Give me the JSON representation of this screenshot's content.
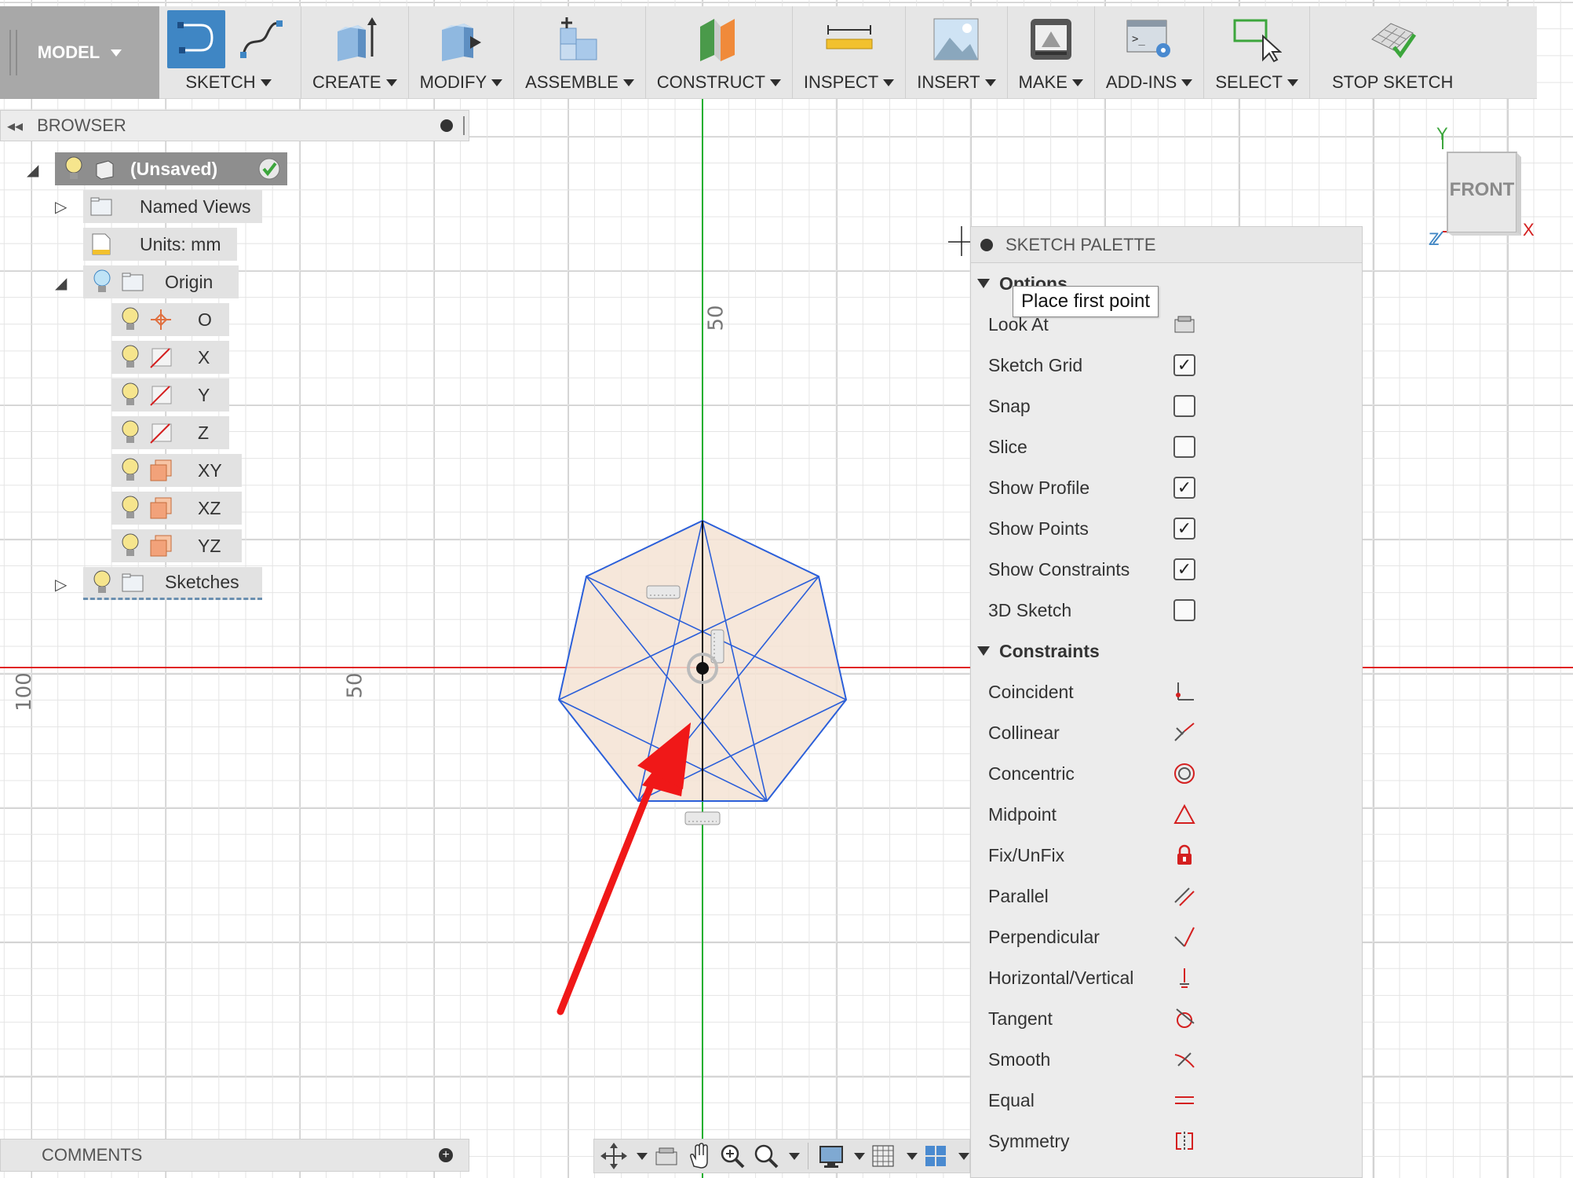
{
  "toolbar": {
    "model_label": "MODEL",
    "groups": [
      {
        "label": "SKETCH"
      },
      {
        "label": "CREATE"
      },
      {
        "label": "MODIFY"
      },
      {
        "label": "ASSEMBLE"
      },
      {
        "label": "CONSTRUCT"
      },
      {
        "label": "INSPECT"
      },
      {
        "label": "INSERT"
      },
      {
        "label": "MAKE"
      },
      {
        "label": "ADD-INS"
      },
      {
        "label": "SELECT"
      },
      {
        "label": "STOP SKETCH"
      }
    ]
  },
  "browser": {
    "title": "BROWSER",
    "items": [
      {
        "label": "(Unsaved)"
      },
      {
        "label": "Named Views"
      },
      {
        "label": "Units: mm"
      },
      {
        "label": "Origin"
      },
      {
        "label": "O"
      },
      {
        "label": "X"
      },
      {
        "label": "Y"
      },
      {
        "label": "Z"
      },
      {
        "label": "XY"
      },
      {
        "label": "XZ"
      },
      {
        "label": "YZ"
      },
      {
        "label": "Sketches"
      }
    ]
  },
  "canvas": {
    "ruler_labels": [
      "50",
      "100",
      "50"
    ]
  },
  "viewcube": {
    "face": "FRONT",
    "axes": [
      "Y",
      "X",
      "Z"
    ]
  },
  "palette": {
    "title": "SKETCH PALETTE",
    "options_label": "Options",
    "options": [
      {
        "label": "Look At",
        "control": "look-at-icon"
      },
      {
        "label": "Sketch Grid",
        "checked": true
      },
      {
        "label": "Snap",
        "checked": false
      },
      {
        "label": "Slice",
        "checked": false
      },
      {
        "label": "Show Profile",
        "checked": true
      },
      {
        "label": "Show Points",
        "checked": true
      },
      {
        "label": "Show Constraints",
        "checked": true
      },
      {
        "label": "3D Sketch",
        "checked": false
      }
    ],
    "constraints_label": "Constraints",
    "constraints": [
      {
        "label": "Coincident",
        "icon": "coincident-icon"
      },
      {
        "label": "Collinear",
        "icon": "collinear-icon"
      },
      {
        "label": "Concentric",
        "icon": "concentric-icon"
      },
      {
        "label": "Midpoint",
        "icon": "midpoint-icon"
      },
      {
        "label": "Fix/UnFix",
        "icon": "lock-icon"
      },
      {
        "label": "Parallel",
        "icon": "parallel-icon"
      },
      {
        "label": "Perpendicular",
        "icon": "perpendicular-icon"
      },
      {
        "label": "Horizontal/Vertical",
        "icon": "horizontal-vertical-icon"
      },
      {
        "label": "Tangent",
        "icon": "tangent-icon"
      },
      {
        "label": "Smooth",
        "icon": "smooth-icon"
      },
      {
        "label": "Equal",
        "icon": "equal-icon"
      },
      {
        "label": "Symmetry",
        "icon": "symmetry-icon"
      }
    ]
  },
  "tooltip": "Place first point",
  "comments": {
    "title": "COMMENTS"
  },
  "colors": {
    "accent": "#3f86c4",
    "x_axis": "#e02020",
    "y_axis": "#20b030",
    "constraint_red": "#d42020",
    "profile_fill": "#f5e3d3",
    "sketch_line": "#2b5fd9"
  }
}
